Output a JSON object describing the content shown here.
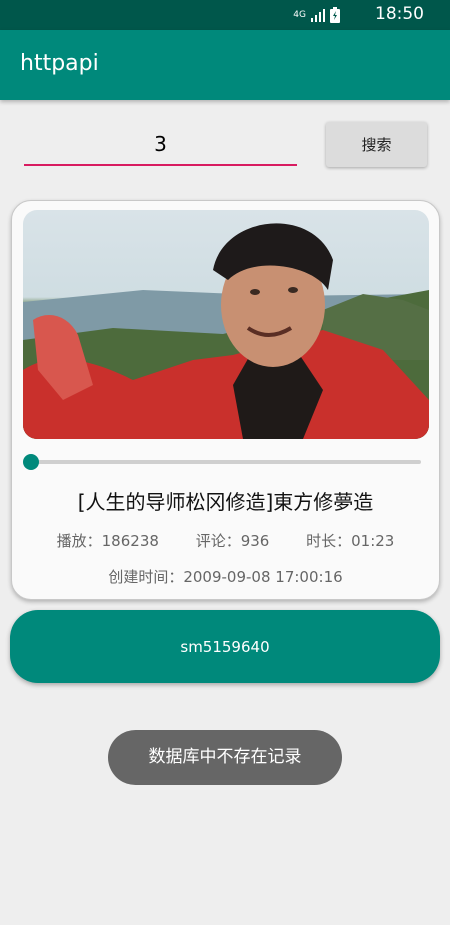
{
  "status_bar": {
    "network": "4G",
    "time": "18:50"
  },
  "app_bar": {
    "title": "httpapi"
  },
  "search": {
    "value": "3",
    "button_label": "搜索"
  },
  "video": {
    "progress": 0,
    "title": "[人生的导师松冈修造]東方修夢造",
    "plays": "播放：186238",
    "comments": "评论：936",
    "duration": "时长：01:23",
    "created": "创建时间：2009-09-08 17:00:16"
  },
  "video_id_button": {
    "label": "sm5159640"
  },
  "toast": {
    "message": "数据库中不存在记录"
  },
  "colors": {
    "primary": "#00897b",
    "primary_dark": "#00574b",
    "accent": "#d81b60"
  },
  "icons": [
    "signal-icon",
    "battery-icon"
  ]
}
